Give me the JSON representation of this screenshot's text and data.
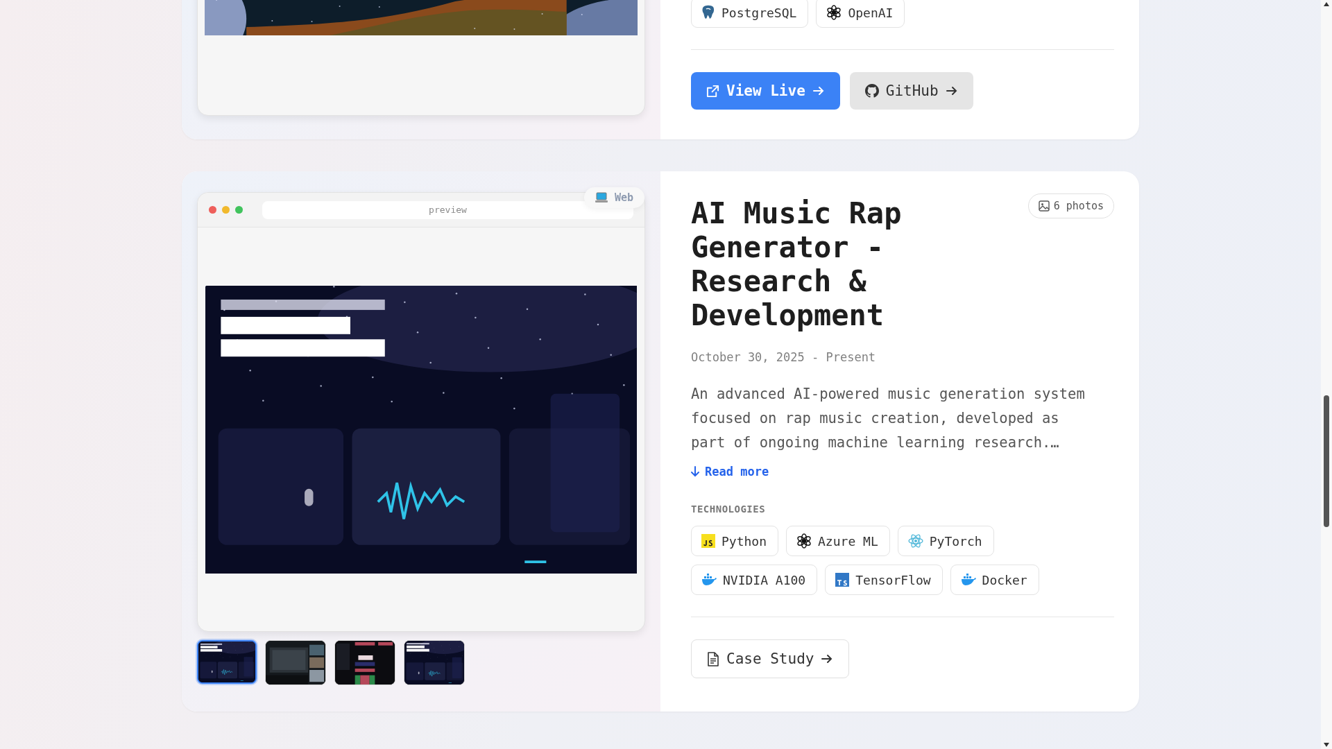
{
  "projects": [
    {
      "technologies": [
        {
          "name": "PostgreSQL",
          "kind": "postgres"
        },
        {
          "name": "OpenAI",
          "kind": "openai"
        }
      ],
      "actions": [
        {
          "label": "View Live",
          "kind": "primary"
        },
        {
          "label": "GitHub",
          "kind": "github"
        }
      ]
    },
    {
      "preview": {
        "kind": "picture",
        "address": "preview",
        "badge": "Web"
      },
      "thumbnails": [
        {
          "selected": true
        },
        {
          "selected": false
        },
        {
          "selected": false
        },
        {
          "selected": false
        }
      ],
      "title": "AI Music Rap Generator - Research & Development",
      "photo_count": "6 photos",
      "date": "October 30, 2025 - Present",
      "description": "An advanced AI-powered music generation system focused on rap music creation, developed as part of ongoing machine learning research.…",
      "read_more": "Read more",
      "section_label": "TECHNOLOGIES",
      "technologies": [
        {
          "name": "Python",
          "kind": "js"
        },
        {
          "name": "Azure ML",
          "kind": "openai"
        },
        {
          "name": "PyTorch",
          "kind": "react"
        },
        {
          "name": "NVIDIA A100",
          "kind": "docker"
        },
        {
          "name": "TensorFlow",
          "kind": "ts"
        },
        {
          "name": "Docker",
          "kind": "docker"
        }
      ],
      "actions": [
        {
          "label": "Case Study",
          "kind": "outline"
        }
      ]
    }
  ]
}
